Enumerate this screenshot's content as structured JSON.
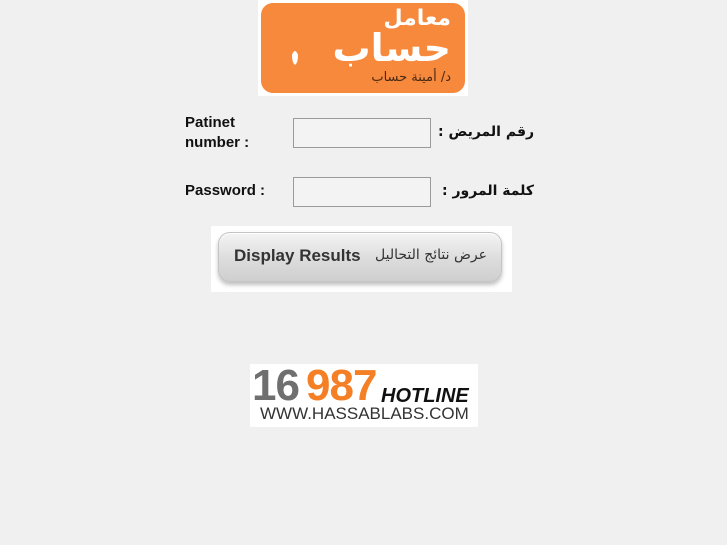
{
  "logo": {
    "line1": "معامل",
    "line2": "حساب",
    "line3": "د/ أمينة حساب",
    "bg_color": "#f7893d"
  },
  "form": {
    "patient_label_en": "Patinet number :",
    "patient_label_ar": "رقم المريض :",
    "patient_value": "",
    "password_label_en": "Password :",
    "password_label_ar": "كلمة المرور :",
    "password_value": ""
  },
  "button": {
    "label_en": "Display Results",
    "label_ar": "عرض نتائج التحاليل"
  },
  "hotline": {
    "number_part1": "16",
    "number_part2": "987",
    "word": "HOTLINE",
    "url": "WWW.HASSABLABS.COM",
    "accent_color": "#f47f24"
  }
}
